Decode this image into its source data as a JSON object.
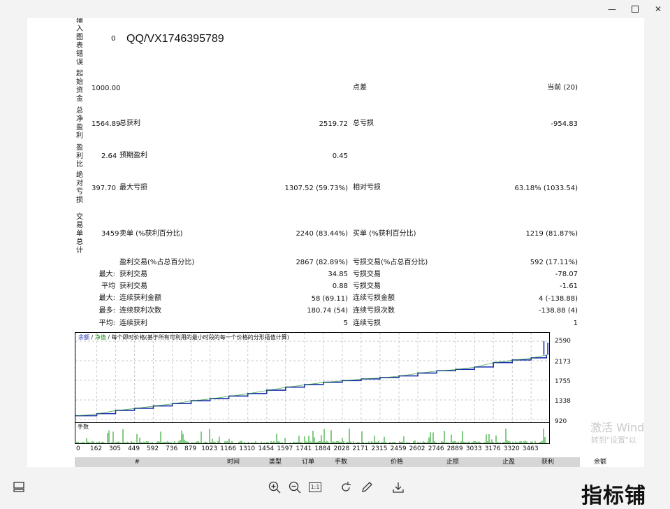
{
  "window": {
    "minimize_icon": "minimize-icon",
    "maximize_icon": "maximize-icon",
    "close_icon": "close-icon"
  },
  "report": {
    "labels": {
      "chart_error": "输入图表错误",
      "initial_deposit": "起始资金",
      "total_net_profit": "总净盈利",
      "profit_factor": "盈利比",
      "absolute_drawdown": "绝对亏损",
      "total_trades": "交易单总计"
    },
    "chart_error_value": "0",
    "qq": "QQ/VX1746395789",
    "initial_deposit": "1000.00",
    "spread_label": "点差",
    "spread_value": "当前 (20)",
    "total_net_profit": "1564.89",
    "gross_profit_label": "总获利",
    "gross_profit": "2519.72",
    "gross_loss_label": "总亏损",
    "gross_loss": "-954.83",
    "profit_factor": "2.64",
    "expected_payoff_label": "预期盈利",
    "expected_payoff": "0.45",
    "absolute_drawdown": "397.70",
    "max_drawdown_label": "最大亏损",
    "max_drawdown": "1307.52 (59.73%)",
    "relative_drawdown_label": "相对亏损",
    "relative_drawdown": "63.18% (1033.54)",
    "total_trades": "3459",
    "short_label": "卖单 (%获利百分比)",
    "short_value": "2240 (83.44%)",
    "long_label": "买单 (%获利百分比)",
    "long_value": "1219 (81.87%)",
    "profit_trades_label": "盈利交易(%占总百分比)",
    "profit_trades": "2867 (82.89%)",
    "loss_trades_label": "亏损交易(%占总百分比)",
    "loss_trades": "592 (17.11%)",
    "rows": [
      {
        "prefix": "最大:",
        "left_label": "获利交易",
        "left_value": "34.85",
        "right_label": "亏损交易",
        "right_value": "-78.07"
      },
      {
        "prefix": "平均",
        "left_label": "获利交易",
        "left_value": "0.88",
        "right_label": "亏损交易",
        "right_value": "-1.61"
      },
      {
        "prefix": "最大:",
        "left_label": "连续获利金额",
        "left_value": "58 (69.11)",
        "right_label": "连续亏损金额",
        "right_value": "4 (-138.88)"
      },
      {
        "prefix": "最多:",
        "left_label": "连续获利次数",
        "left_value": "180.74 (54)",
        "right_label": "连续亏损次数",
        "right_value": "-138.88 (4)"
      },
      {
        "prefix": "平均:",
        "left_label": "连续获利",
        "left_value": "5",
        "right_label": "连续亏损",
        "right_value": "1"
      }
    ]
  },
  "chart_data": {
    "type": "line",
    "legend": {
      "balance": "余额",
      "sep1": "/",
      "equity": "净值",
      "sep2": "/",
      "note": "每个即时价格(基于所有可利用的最小时段的每一个价格的分形插值计算)"
    },
    "volume_label": "手数",
    "y_ticks": [
      "2590",
      "2173",
      "1755",
      "1338",
      "920"
    ],
    "ylim": [
      920,
      2590
    ],
    "x_ticks": [
      "0",
      "162",
      "305",
      "449",
      "592",
      "736",
      "879",
      "1023",
      "1166",
      "1310",
      "1454",
      "1597",
      "1741",
      "1884",
      "2028",
      "2171",
      "2315",
      "2459",
      "2602",
      "2746",
      "2889",
      "3033",
      "3176",
      "3320",
      "3463"
    ],
    "xlim": [
      0,
      3600
    ],
    "balance_series": [
      [
        0,
        1000
      ],
      [
        162,
        1045
      ],
      [
        305,
        1115
      ],
      [
        449,
        1160
      ],
      [
        592,
        1210
      ],
      [
        736,
        1260
      ],
      [
        879,
        1320
      ],
      [
        1023,
        1365
      ],
      [
        1166,
        1420
      ],
      [
        1310,
        1475
      ],
      [
        1454,
        1545
      ],
      [
        1597,
        1610
      ],
      [
        1741,
        1665
      ],
      [
        1884,
        1715
      ],
      [
        2028,
        1750
      ],
      [
        2171,
        1785
      ],
      [
        2315,
        1815
      ],
      [
        2459,
        1850
      ],
      [
        2602,
        1910
      ],
      [
        2746,
        1960
      ],
      [
        2889,
        1990
      ],
      [
        3033,
        2040
      ],
      [
        3176,
        2135
      ],
      [
        3320,
        2190
      ],
      [
        3463,
        2235
      ],
      [
        3580,
        2300
      ]
    ],
    "spikes": [
      [
        3560,
        2590
      ],
      [
        3590,
        2560
      ]
    ],
    "colors": {
      "balance": "#1a2fb0",
      "equity": "#0a8a0a",
      "volume": "#0a9a0a",
      "grid": "#c8c8c8"
    }
  },
  "table_header": [
    "#",
    "时间",
    "类型",
    "订单",
    "手数",
    "价格",
    "止损",
    "止盈",
    "获利",
    "余额"
  ],
  "watermark": {
    "line1": "激活 Wind",
    "line2": "转到\"设置\"以"
  },
  "toolbar": {
    "layout_icon": "layout-icon",
    "zoom_in_icon": "zoom-in-icon",
    "zoom_out_icon": "zoom-out-icon",
    "actual_size_label": "1:1",
    "rotate_icon": "rotate-icon",
    "edit_icon": "edit-icon",
    "download_icon": "download-icon"
  },
  "brand": "指标铺"
}
